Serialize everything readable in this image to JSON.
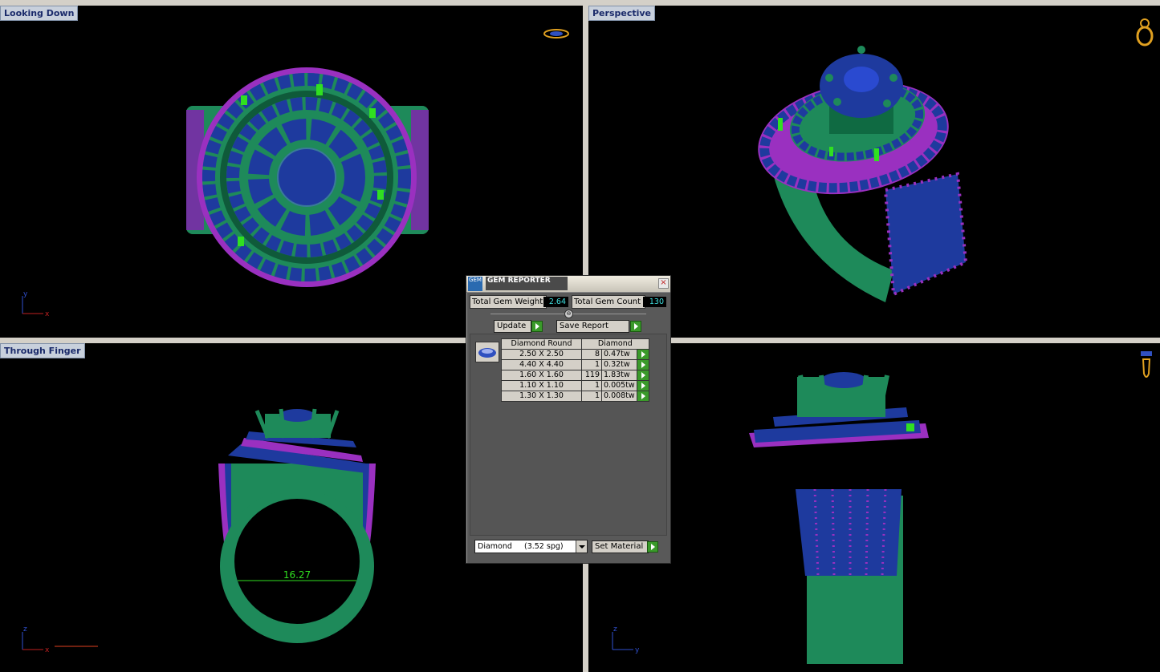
{
  "viewports": {
    "top_left": {
      "label": "Looking Down",
      "axis_v": "y",
      "axis_h": "x"
    },
    "top_right": {
      "label": "Perspective"
    },
    "bottom_left": {
      "label": "Through Finger",
      "axis_v": "z",
      "axis_h": "x",
      "measurement": "16.27"
    },
    "bottom_right": {
      "axis_v": "z",
      "axis_h": "y"
    }
  },
  "gem_reporter": {
    "title": "GEM REPORTER",
    "logo_text": "GEM",
    "close_glyph": "×",
    "total_weight_label": "Total Gem Weight",
    "total_weight_value": "2.64",
    "total_count_label": "Total Gem Count",
    "total_count_value": "130",
    "collapse_glyph": "⊖",
    "update_label": "Update",
    "save_report_label": "Save Report",
    "table_headers": [
      "Diamond Round",
      "Diamond"
    ],
    "rows": [
      {
        "size": "2.50 X 2.50",
        "count": "8",
        "weight": "0.47tw"
      },
      {
        "size": "4.40 X 4.40",
        "count": "1",
        "weight": "0.32tw"
      },
      {
        "size": "1.60 X 1.60",
        "count": "119",
        "weight": "1.83tw"
      },
      {
        "size": "1.10 X 1.10",
        "count": "1",
        "weight": "0.005tw"
      },
      {
        "size": "1.30 X 1.30",
        "count": "1",
        "weight": "0.008tw"
      }
    ],
    "material_select": "Diamond     (3.52 spg)",
    "set_material_label": "Set Material"
  },
  "colors": {
    "metal": "#1e8a5a",
    "gem": "#1e3a9e",
    "prong": "#9a30c0",
    "highlight": "#30e020",
    "measure": "#30e020"
  },
  "icons": [
    "ring-top-icon",
    "ring-perspective-icon",
    "ring-side-icon",
    "axis-triad-icon"
  ]
}
